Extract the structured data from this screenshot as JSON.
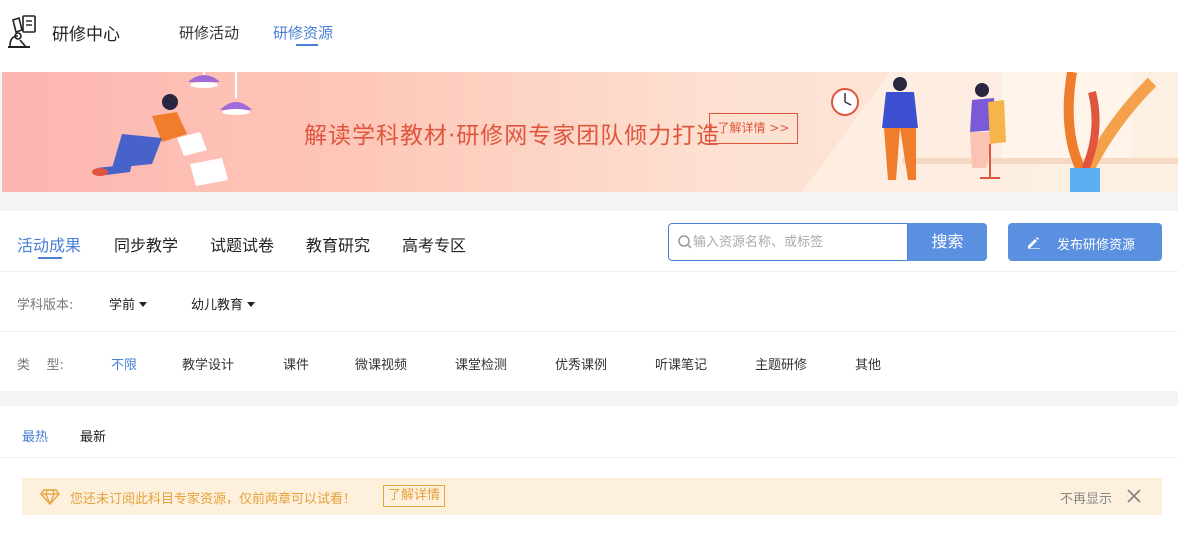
{
  "header": {
    "brand": "研修中心",
    "nav": [
      {
        "label": "研修活动",
        "active": false
      },
      {
        "label": "研修资源",
        "active": true
      }
    ]
  },
  "banner": {
    "slogan": "解读学科教材·研修网专家团队倾力打造",
    "button_label": "了解详情 >>"
  },
  "categories": [
    {
      "label": "活动成果",
      "active": true
    },
    {
      "label": "同步教学",
      "active": false
    },
    {
      "label": "试题试卷",
      "active": false
    },
    {
      "label": "教育研究",
      "active": false
    },
    {
      "label": "高考专区",
      "active": false
    }
  ],
  "search": {
    "placeholder": "输入资源名称、或标签",
    "button_label": "搜索"
  },
  "publish_button": "发布研修资源",
  "subject_row": {
    "label": "学科版本:",
    "dropdowns": [
      "学前",
      "幼儿教育"
    ]
  },
  "type_row": {
    "label": "类    型:",
    "items": [
      {
        "label": "不限",
        "active": true
      },
      {
        "label": "教学设计",
        "active": false
      },
      {
        "label": "课件",
        "active": false
      },
      {
        "label": "微课视频",
        "active": false
      },
      {
        "label": "课堂检测",
        "active": false
      },
      {
        "label": "优秀课例",
        "active": false
      },
      {
        "label": "听课笔记",
        "active": false
      },
      {
        "label": "主题研修",
        "active": false
      },
      {
        "label": "其他",
        "active": false
      }
    ]
  },
  "sort_tabs": [
    {
      "label": "最热",
      "active": true
    },
    {
      "label": "最新",
      "active": false
    }
  ],
  "notice": {
    "text": "您还未订阅此科目专家资源，仅前两章可以试看！",
    "link_label": "了解详情",
    "dismiss_label": "不再显示"
  },
  "colors": {
    "accent": "#4a7fd6",
    "button": "#5b8fe0",
    "banner_text": "#e0553d",
    "notice_text": "#e6a23c",
    "notice_bg": "#fdf0dc"
  }
}
